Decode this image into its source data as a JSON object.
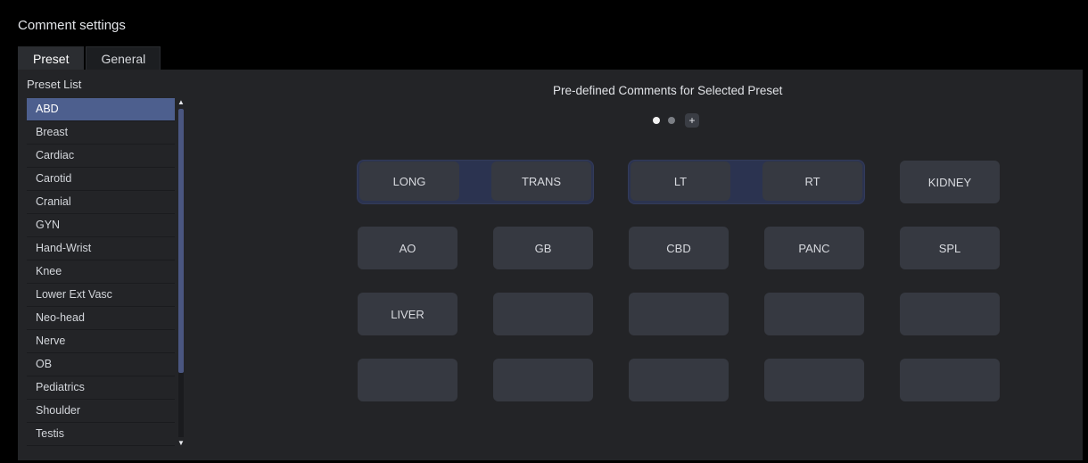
{
  "window": {
    "title": "Comment settings"
  },
  "tabs": [
    {
      "label": "Preset",
      "active": true
    },
    {
      "label": "General",
      "active": false
    }
  ],
  "preset_list": {
    "header": "Preset List",
    "selected": "ABD",
    "items": [
      "ABD",
      "Breast",
      "Cardiac",
      "Carotid",
      "Cranial",
      "GYN",
      "Hand-Wrist",
      "Knee",
      "Lower Ext Vasc",
      "Neo-head",
      "Nerve",
      "OB",
      "Pediatrics",
      "Shoulder",
      "Testis"
    ]
  },
  "comments": {
    "title": "Pre-defined Comments for Selected Preset",
    "pager": {
      "pages": 2,
      "current": 1,
      "add_label": "+"
    },
    "rows": [
      [
        "LONG",
        "TRANS",
        "LT",
        "RT",
        "KIDNEY"
      ],
      [
        "AO",
        "GB",
        "CBD",
        "PANC",
        "SPL"
      ],
      [
        "LIVER",
        "",
        "",
        "",
        ""
      ],
      [
        "",
        "",
        "",
        "",
        ""
      ]
    ],
    "grouped_pairs": [
      [
        "LONG",
        "TRANS"
      ],
      [
        "LT",
        "RT"
      ]
    ]
  },
  "colors": {
    "background": "#000000",
    "panel": "#232427",
    "selected_item": "#4d5f8e",
    "button": "#363941",
    "pair_group": "#2b3350"
  }
}
